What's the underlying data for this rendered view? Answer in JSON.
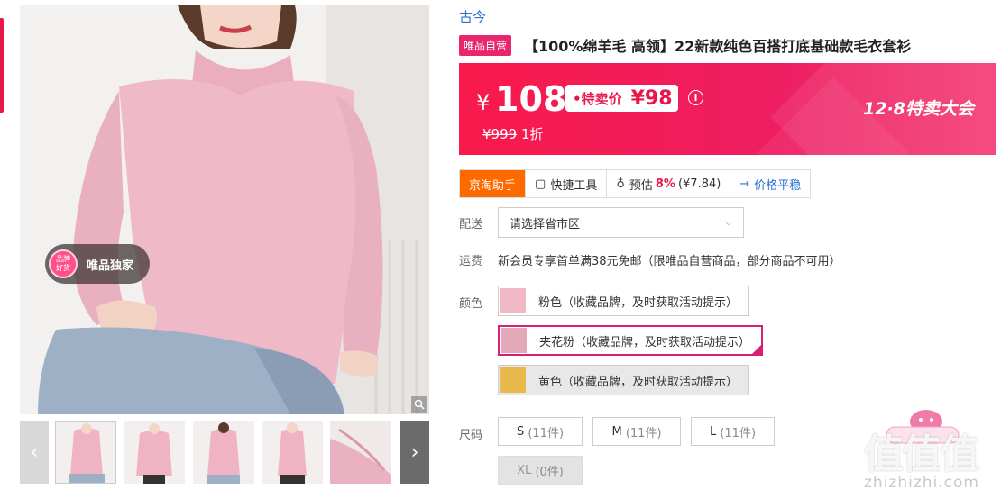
{
  "gallery": {
    "badge_circle": "品牌好货",
    "badge_text": "唯品独家",
    "thumb_count": 5
  },
  "product": {
    "brand": "古今",
    "store_tag": "唯品自营",
    "title": "【100%绵羊毛 高领】22新款纯色百搭打底基础款毛衣套衫"
  },
  "price": {
    "currency": "¥",
    "main": "108",
    "sale_label": "•特卖价",
    "sale_value": "¥98",
    "info_icon": "i",
    "original": "¥999",
    "discount": "1折",
    "event": "12·8特卖大会"
  },
  "tools": {
    "helper": "京淘助手",
    "quick": "快捷工具",
    "estimate_label": "预估",
    "estimate_pct": "8%",
    "estimate_amount": "(¥7.84)",
    "price_trend": "价格平稳"
  },
  "delivery": {
    "label": "配送",
    "placeholder": "请选择省市区"
  },
  "shipping": {
    "label": "运费",
    "text": "新会员专享首单满38元免邮（限唯品自营商品，部分商品不可用）"
  },
  "colors": {
    "label": "颜色",
    "options": [
      {
        "name": "粉色（收藏品牌，及时获取活动提示）",
        "swatch": "#f1b9c6",
        "state": "normal"
      },
      {
        "name": "夹花粉（收藏品牌，及时获取活动提示）",
        "swatch": "#e4a9b8",
        "state": "selected"
      },
      {
        "name": "黄色（收藏品牌，及时获取活动提示）",
        "swatch": "#e8b84a",
        "state": "disabled"
      }
    ]
  },
  "sizes": {
    "label": "尺码",
    "options": [
      {
        "size": "S",
        "count": "(11件)",
        "state": "normal"
      },
      {
        "size": "M",
        "count": "(11件)",
        "state": "normal"
      },
      {
        "size": "L",
        "count": "(11件)",
        "state": "normal"
      },
      {
        "size": "XL",
        "count": "(0件)",
        "state": "disabled"
      }
    ]
  },
  "watermark": {
    "logo": "值值值",
    "url": "zhizhizhi.com"
  },
  "colors_theme": {
    "accent": "#e8174a",
    "brand_link": "#2a6fd6",
    "helper_orange": "#ff6a00",
    "selected_border": "#d81e75"
  }
}
